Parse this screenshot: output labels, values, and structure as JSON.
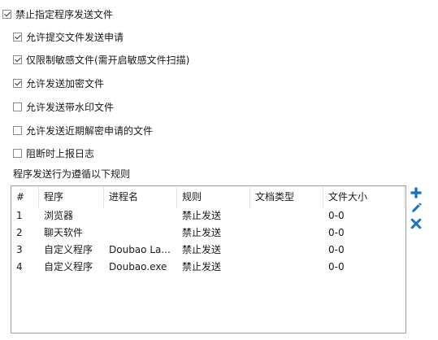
{
  "checkboxes": [
    {
      "label": "禁止指定程序发送文件",
      "checked": true
    },
    {
      "label": "允许提交文件发送申请",
      "checked": true
    },
    {
      "label": "仅限制敏感文件(需开启敏感文件扫描)",
      "checked": true
    },
    {
      "label": "允许发送加密文件",
      "checked": true
    },
    {
      "label": "允许发送带水印文件",
      "checked": false
    },
    {
      "label": "允许发送近期解密申请的文件",
      "checked": false
    },
    {
      "label": "阻断时上报日志",
      "checked": false
    }
  ],
  "rules_caption": "程序发送行为遵循以下规则",
  "table": {
    "headers": [
      "#",
      "程序",
      "进程名",
      "规则",
      "文档类型",
      "文件大小"
    ],
    "rows": [
      {
        "num": "1",
        "program": "浏览器",
        "process": "",
        "rule": "禁止发送",
        "doctype": "",
        "size": "0-0"
      },
      {
        "num": "2",
        "program": "聊天软件",
        "process": "",
        "rule": "禁止发送",
        "doctype": "",
        "size": "0-0"
      },
      {
        "num": "3",
        "program": "自定义程序",
        "process": "Doubao La...",
        "rule": "禁止发送",
        "doctype": "",
        "size": "0-0"
      },
      {
        "num": "4",
        "program": "自定义程序",
        "process": "Doubao.exe",
        "rule": "禁止发送",
        "doctype": "",
        "size": "0-0"
      }
    ]
  },
  "actions": {
    "add_icon": "plus-icon",
    "edit_icon": "pencil-icon",
    "delete_icon": "x-icon",
    "icon_color": "#1e73be"
  }
}
